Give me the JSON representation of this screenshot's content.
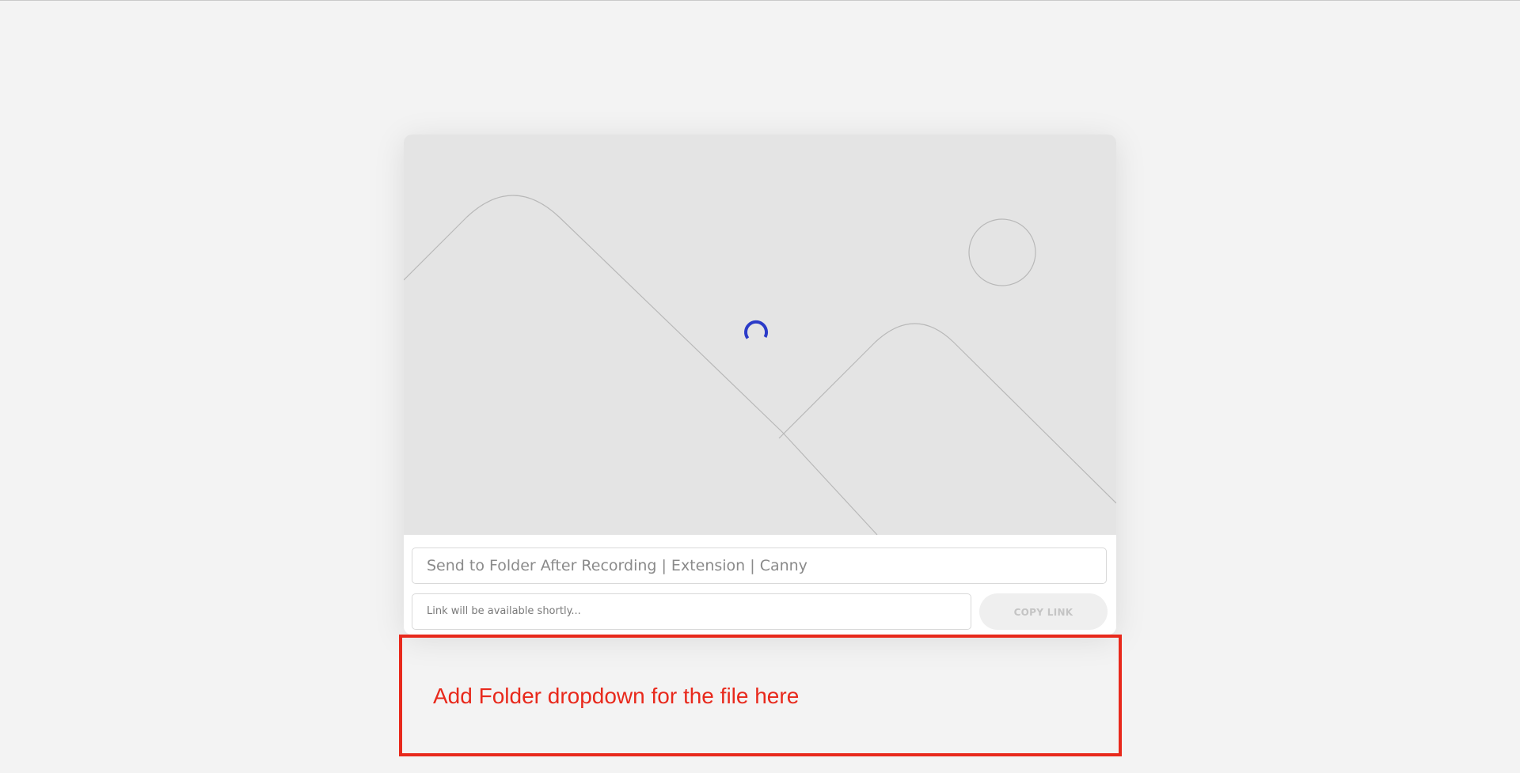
{
  "recording": {
    "title_value": "Send to Folder After Recording | Extension | Canny",
    "link_placeholder": "Link will be available shortly...",
    "copy_link_label": "COPY LINK"
  },
  "preview": {
    "state": "loading",
    "placeholder_icon": "image-placeholder-icon",
    "spinner_icon": "loading-spinner-icon",
    "spinner_color": "#2b3bc8"
  },
  "annotation": {
    "text": "Add Folder dropdown for the file here",
    "color": "#e8291c"
  }
}
